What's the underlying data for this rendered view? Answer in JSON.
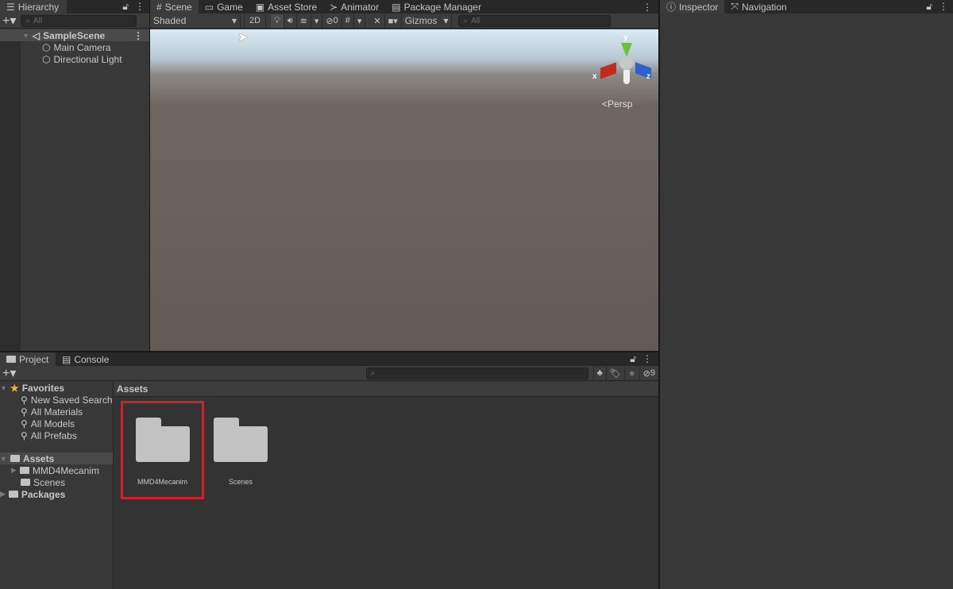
{
  "hierarchy": {
    "tab": "Hierarchy",
    "search_placeholder": "All",
    "scene": "SampleScene",
    "items": [
      "Main Camera",
      "Directional Light"
    ]
  },
  "scene_tabs": [
    {
      "label": "Scene",
      "icon": "grid-icon"
    },
    {
      "label": "Game",
      "icon": "gamepad-icon"
    },
    {
      "label": "Asset Store",
      "icon": "bag-icon"
    },
    {
      "label": "Animator",
      "icon": "animator-icon"
    },
    {
      "label": "Package Manager",
      "icon": "package-icon"
    }
  ],
  "scene_toolbar": {
    "shading": "Shaded",
    "mode_2d": "2D",
    "hidden_count": "0",
    "gizmos": "Gizmos",
    "search_placeholder": "All"
  },
  "gizmo": {
    "x": "x",
    "y": "y",
    "z": "z",
    "projection": "Persp"
  },
  "inspector_tabs": [
    "Inspector",
    "Navigation"
  ],
  "project": {
    "tabs": [
      "Project",
      "Console"
    ],
    "hidden_count": "9",
    "favorites": {
      "label": "Favorites",
      "items": [
        "New Saved Search",
        "All Materials",
        "All Models",
        "All Prefabs"
      ]
    },
    "assets_tree": {
      "label": "Assets",
      "children": [
        "MMD4Mecanim",
        "Scenes"
      ]
    },
    "packages": "Packages",
    "breadcrumb": "Assets",
    "grid_items": [
      "MMD4Mecanim",
      "Scenes"
    ],
    "highlight_color": "#d4202a"
  }
}
